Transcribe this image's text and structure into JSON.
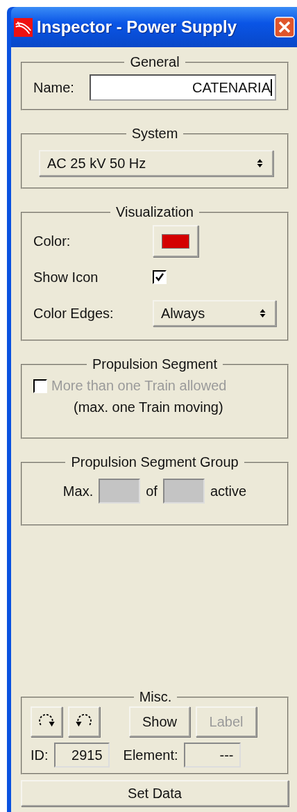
{
  "window": {
    "title": "Inspector - Power Supply"
  },
  "general": {
    "title": "General",
    "name_label": "Name:",
    "name_value": "CATENARIA"
  },
  "system": {
    "title": "System",
    "value": "AC 25 kV 50 Hz"
  },
  "visualization": {
    "title": "Visualization",
    "color_label": "Color:",
    "color": "#d40000",
    "show_icon_label": "Show Icon",
    "show_icon_checked": true,
    "color_edges_label": "Color Edges:",
    "color_edges_value": "Always"
  },
  "propulsion_segment": {
    "title": "Propulsion Segment",
    "option_label": "More than one Train allowed",
    "checked": false,
    "disabled": true,
    "note": "(max. one Train moving)"
  },
  "propulsion_segment_group": {
    "title": "Propulsion Segment Group",
    "max_label": "Max.",
    "max_disabled": true,
    "of_label": "of",
    "of_disabled": true,
    "active_label": "active"
  },
  "misc": {
    "title": "Misc.",
    "buttons": [
      {
        "kind": "rotate-cw"
      },
      {
        "kind": "rotate-ccw"
      },
      {
        "kind": "text",
        "label": "Show",
        "disabled": false
      },
      {
        "kind": "text",
        "label": "Label",
        "disabled": true
      }
    ],
    "id_label": "ID:",
    "id_value": "2915",
    "element_label": "Element:",
    "element_value": "---"
  },
  "set_data": "Set Data"
}
